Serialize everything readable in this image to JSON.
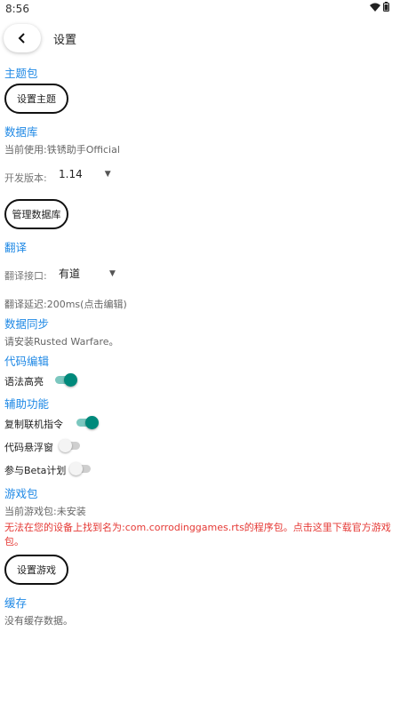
{
  "status_bar": {
    "time": "8:56"
  },
  "toolbar": {
    "title": "设置"
  },
  "theme": {
    "header": "主题包",
    "button": "设置主题"
  },
  "database": {
    "header": "数据库",
    "current": "当前使用:铁锈助手Official",
    "version_label": "开发版本:",
    "version_value": "1.14",
    "manage_button": "管理数据库"
  },
  "translate": {
    "header": "翻译",
    "api_label": "翻译接口:",
    "api_value": "有道",
    "delay": "翻译延迟:200ms(点击编辑)"
  },
  "sync": {
    "header": "数据同步",
    "message": "请安装Rusted Warfare。"
  },
  "code_edit": {
    "header": "代码编辑",
    "syntax_label": "语法高亮",
    "syntax_on": true
  },
  "assist": {
    "header": "辅助功能",
    "copy_label": "复制联机指令",
    "copy_on": true,
    "float_label": "代码悬浮窗",
    "float_on": false,
    "beta_label": "参与Beta计划",
    "beta_on": false
  },
  "game": {
    "header": "游戏包",
    "current": "当前游戏包:未安装",
    "error": "无法在您的设备上找到名为:com.corrodinggames.rts的程序包。点击这里下载官方游戏包。",
    "button": "设置游戏"
  },
  "cache": {
    "header": "缓存",
    "message": "没有缓存数据。"
  },
  "colors": {
    "accent": "#1e88e5",
    "switch_on": "#00897b",
    "error": "#e53935"
  }
}
